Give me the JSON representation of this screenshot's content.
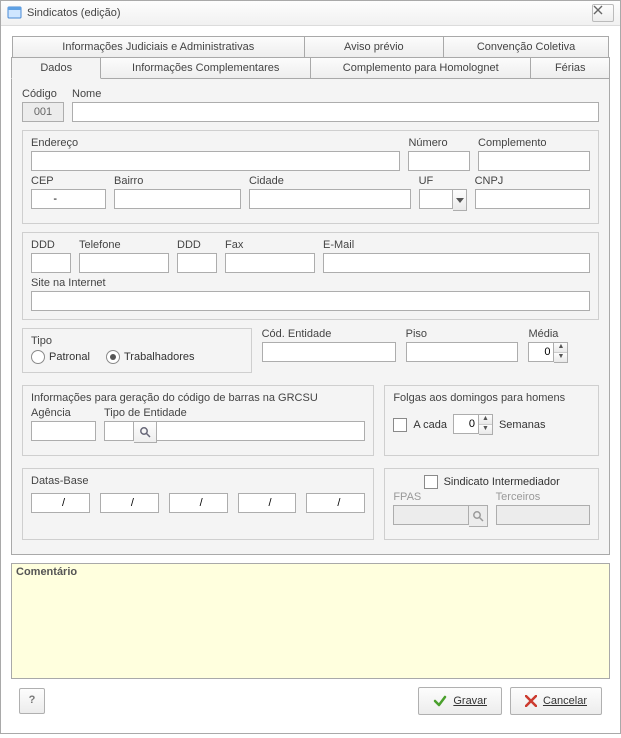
{
  "window": {
    "title": "Sindicatos (edição)"
  },
  "tabs_row1": [
    {
      "label": "Informações Judiciais e Administrativas"
    },
    {
      "label": "Aviso prévio"
    },
    {
      "label": "Convenção Coletiva"
    }
  ],
  "tabs_row2": [
    {
      "label": "Dados",
      "active": true
    },
    {
      "label": "Informações Complementares"
    },
    {
      "label": "Complemento para Homolognet"
    },
    {
      "label": "Férias"
    }
  ],
  "codigo": {
    "label": "Código",
    "value": "001"
  },
  "nome": {
    "label": "Nome",
    "value": ""
  },
  "endereco": {
    "label": "Endereço",
    "value": ""
  },
  "numero": {
    "label": "Número",
    "value": ""
  },
  "complemento": {
    "label": "Complemento",
    "value": ""
  },
  "cep": {
    "label": "CEP",
    "value": "      -"
  },
  "bairro": {
    "label": "Bairro",
    "value": ""
  },
  "cidade": {
    "label": "Cidade",
    "value": ""
  },
  "uf": {
    "label": "UF",
    "value": ""
  },
  "cnpj": {
    "label": "CNPJ",
    "value": ""
  },
  "ddd1": {
    "label": "DDD",
    "value": ""
  },
  "tel": {
    "label": "Telefone",
    "value": ""
  },
  "ddd2": {
    "label": "DDD",
    "value": ""
  },
  "fax": {
    "label": "Fax",
    "value": ""
  },
  "email": {
    "label": "E-Mail",
    "value": ""
  },
  "site": {
    "label": "Site na Internet",
    "value": ""
  },
  "tipo": {
    "label": "Tipo",
    "patronal": "Patronal",
    "trab": "Trabalhadores"
  },
  "cod_entidade": {
    "label": "Cód. Entidade",
    "value": ""
  },
  "piso": {
    "label": "Piso",
    "value": ""
  },
  "media": {
    "label": "Média",
    "value": "0"
  },
  "grcsu": {
    "label": "Informações para geração do código de barras na GRCSU",
    "agencia": "Agência",
    "agencia_value": "",
    "tipo_ent": "Tipo de Entidade",
    "tipo_ent_code": "",
    "tipo_ent_desc": ""
  },
  "folgas": {
    "label": "Folgas aos domingos para homens",
    "acada": "A cada",
    "semanas": "Semanas",
    "value": "0"
  },
  "datas_base": {
    "label": "Datas-Base",
    "d1": "  /",
    "d2": "  /",
    "d3": "  /",
    "d4": "  /",
    "d5": "  /"
  },
  "intermediador": {
    "label": "Sindicato Intermediador",
    "fpas": "FPAS",
    "fpas_value": "",
    "terceiros": "Terceiros",
    "terceiros_value": ""
  },
  "comentario": {
    "label": "Comentário"
  },
  "buttons": {
    "gravar": "Gravar",
    "cancelar": "Cancelar"
  }
}
